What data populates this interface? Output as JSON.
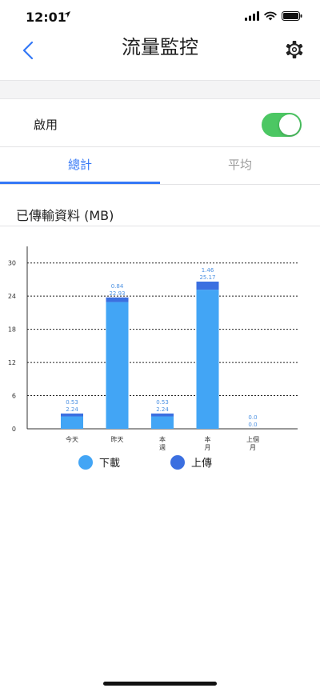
{
  "status_bar": {
    "time": "12:01"
  },
  "header": {
    "title": "流量監控"
  },
  "toggle": {
    "label": "啟用",
    "enabled": true
  },
  "tabs": [
    {
      "label": "總計",
      "selected": true
    },
    {
      "label": "平均",
      "selected": false
    }
  ],
  "section": {
    "title": "已傳輸資料 (MB)"
  },
  "colors": {
    "accent": "#3478f6",
    "toggle_on": "#4cc763",
    "download": "#42a5f5",
    "upload": "#3b6fe0"
  },
  "chart_data": {
    "type": "bar",
    "stacked": true,
    "categories": [
      "今天",
      "昨天",
      "本週",
      "本月",
      "上個月"
    ],
    "category_lines": [
      [
        "今天"
      ],
      [
        "昨天"
      ],
      [
        "本",
        "週"
      ],
      [
        "本",
        "月"
      ],
      [
        "上個",
        "月"
      ]
    ],
    "series": [
      {
        "name": "下載",
        "values": [
          2.24,
          22.93,
          2.24,
          25.17,
          0.0
        ],
        "labels": [
          "2.24",
          "22.93",
          "2.24",
          "25.17",
          "0.0"
        ]
      },
      {
        "name": "上傳",
        "values": [
          0.53,
          0.84,
          0.53,
          1.46,
          0.0
        ],
        "labels": [
          "0.53",
          "0.84",
          "0.53",
          "1.46",
          "0.0"
        ]
      }
    ],
    "yticks": [
      0,
      6,
      12,
      18,
      24,
      30
    ],
    "ylim": [
      0,
      33
    ],
    "grid": "dotted",
    "legend": "bottom"
  }
}
